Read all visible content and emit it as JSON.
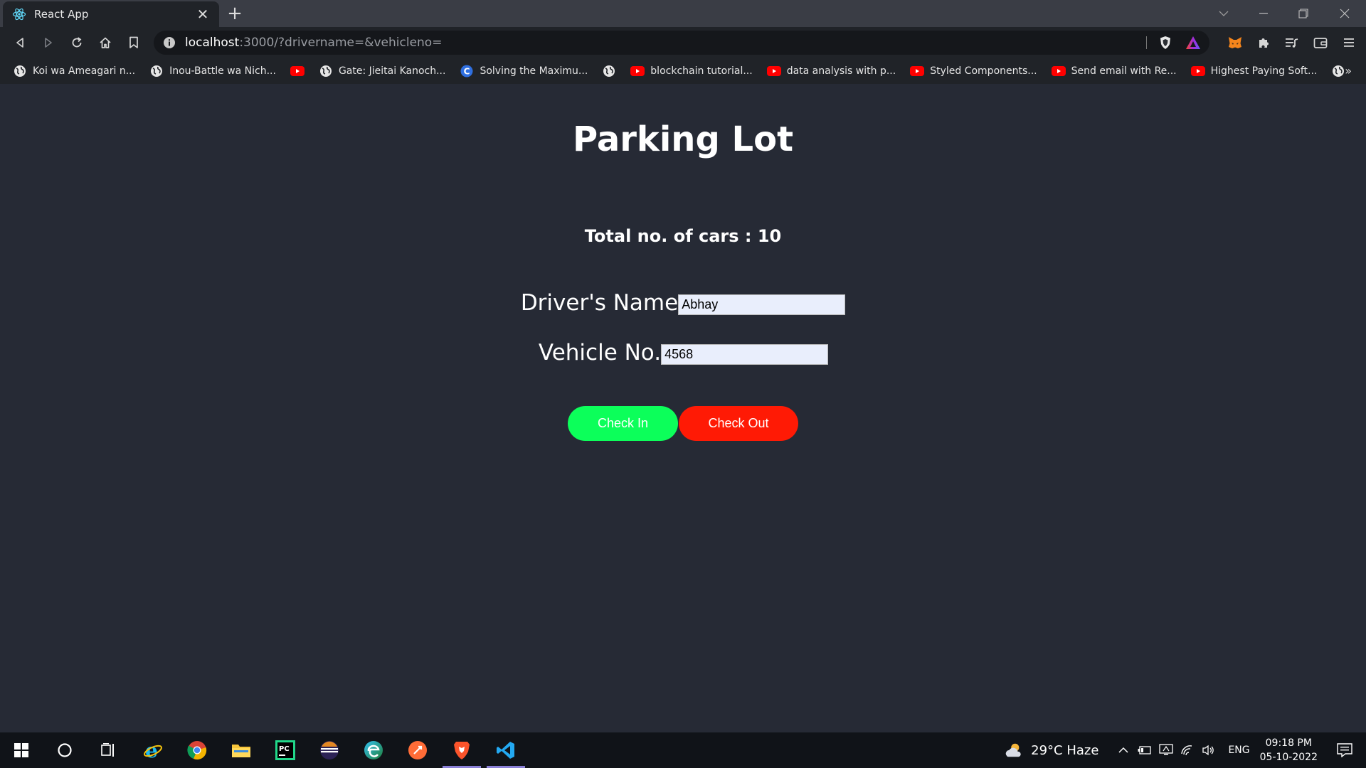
{
  "browser": {
    "tab": {
      "title": "React App"
    },
    "url": {
      "host": "localhost",
      "rest": ":3000/?drivername=&vehicleno="
    },
    "bookmarks": [
      {
        "label": "Koi wa Ameagari n...",
        "icon": "globe-icon"
      },
      {
        "label": "Inou-Battle wa Nich...",
        "icon": "globe-icon"
      },
      {
        "label": "",
        "icon": "youtube-icon"
      },
      {
        "label": "Gate: Jieitai Kanoch...",
        "icon": "globe-icon"
      },
      {
        "label": "Solving the Maximu...",
        "icon": "c-icon"
      },
      {
        "label": "",
        "icon": "globe-icon"
      },
      {
        "label": "blockchain tutorial...",
        "icon": "youtube-icon"
      },
      {
        "label": "data analysis with p...",
        "icon": "youtube-icon"
      },
      {
        "label": "Styled Components...",
        "icon": "youtube-icon"
      },
      {
        "label": "Send email with Re...",
        "icon": "youtube-icon"
      },
      {
        "label": "Highest Paying Soft...",
        "icon": "youtube-icon"
      },
      {
        "label": "",
        "icon": "globe-icon"
      }
    ],
    "bookmarks_more": "»"
  },
  "page": {
    "title": "Parking Lot",
    "car_count": "Total no. of cars : 10",
    "driver_label": "Driver's Name",
    "driver_value": "Abhay",
    "vehicle_label": "Vehicle No.",
    "vehicle_value": "4568",
    "checkin_label": "Check In",
    "checkout_label": "Check Out"
  },
  "taskbar": {
    "weather": "29°C  Haze",
    "lang": "ENG",
    "time": "09:18 PM",
    "date": "05-10-2022"
  },
  "colors": {
    "page_bg": "#262a35",
    "checkin": "#0cff5a",
    "checkout": "#ff1a05",
    "input_bg": "#e9eefc"
  }
}
